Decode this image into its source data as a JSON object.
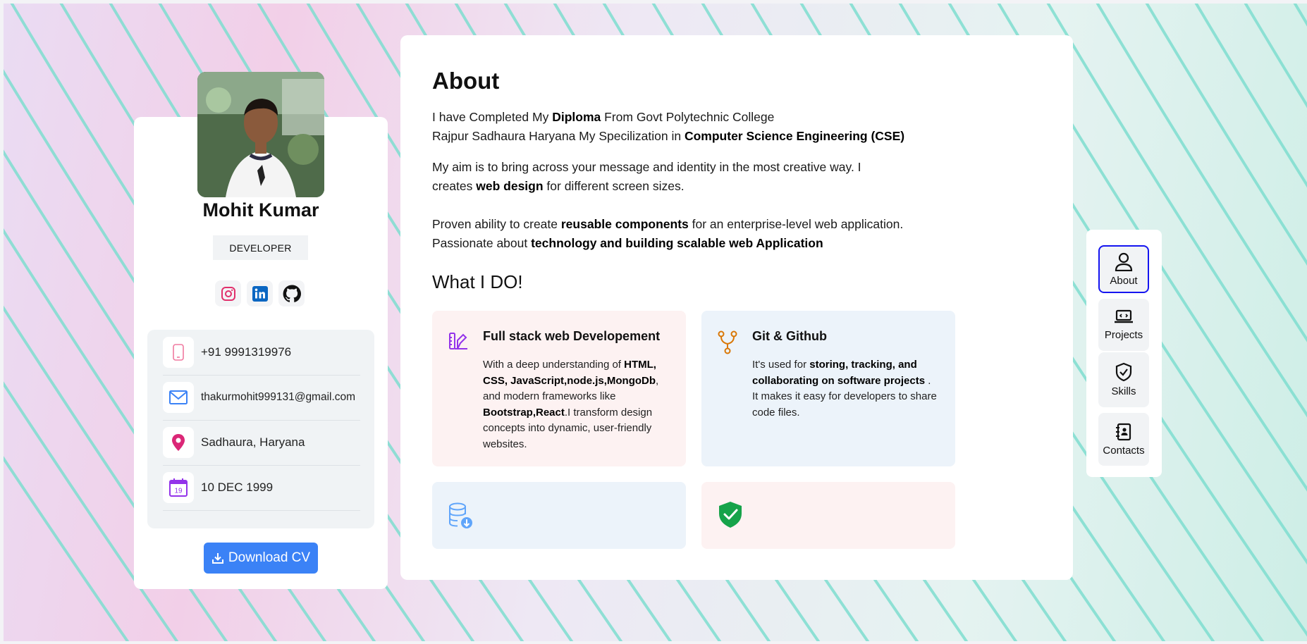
{
  "profile": {
    "name": "Mohit Kumar",
    "role": "DEVELOPER",
    "socials": [
      {
        "icon": "instagram-icon",
        "color": "#e1306c"
      },
      {
        "icon": "linkedin-icon",
        "color": "#0a66c2"
      },
      {
        "icon": "github-icon",
        "color": "#111111"
      }
    ],
    "contacts": [
      {
        "icon": "phone-icon",
        "value": "+91 9991319976"
      },
      {
        "icon": "mail-icon",
        "value": "thakurmohit999131@gmail.com"
      },
      {
        "icon": "location-pin-icon",
        "value": "Sadhaura, Haryana"
      },
      {
        "icon": "calendar-icon",
        "value": "10 DEC 1999",
        "calendar_day": "19"
      }
    ],
    "download_label": "Download CV"
  },
  "about": {
    "title": "About",
    "para1": {
      "a": "I have Completed My ",
      "b": "Diploma",
      "c": " From Govt Polytechnic College",
      "d": "Rajpur Sadhaura Haryana My Specilization in ",
      "e": "Computer Science Engineering (CSE)"
    },
    "para2": {
      "a": "My aim is to bring across your message and identity in the most creative way. I",
      "b": "creates ",
      "c": "web design",
      "d": " for different screen sizes."
    },
    "para3": {
      "a": "Proven ability to create ",
      "b": "reusable components",
      "c": " for an enterprise-level web application.",
      "d": "Passionate about ",
      "e": "technology and building scalable web Application"
    },
    "what_i_do": "What I DO!",
    "services": [
      {
        "icon": "design-tools-icon",
        "title": "Full stack web Developement",
        "desc": {
          "a": "With a deep understanding of ",
          "b": "HTML, CSS, JavaScript,node.js,MongoDb",
          "c": ", and modern frameworks like ",
          "d": "Bootstrap,React",
          "e": ".I transform design concepts into dynamic, user-friendly websites."
        }
      },
      {
        "icon": "git-branch-icon",
        "title": "Git & Github",
        "desc": {
          "a": "It's used for ",
          "b": "storing, tracking, and collaborating on software projects",
          "c": " . It makes it easy for developers to share code files."
        }
      },
      {
        "icon": "database-download-icon"
      },
      {
        "icon": "shield-check-icon"
      }
    ]
  },
  "nav": {
    "items": [
      {
        "label": "About",
        "icon": "user-icon",
        "active": true
      },
      {
        "label": "Projects",
        "icon": "laptop-icon"
      },
      {
        "label": "Skills",
        "icon": "badge-check-icon"
      },
      {
        "label": "Contacts",
        "icon": "address-book-icon"
      }
    ]
  },
  "colors": {
    "accent_blue": "#3b82f6",
    "active_border": "#1515f0",
    "pink_card": "#fdf2f2",
    "blue_card": "#ecf3fa",
    "stripe": "#7fded0"
  }
}
